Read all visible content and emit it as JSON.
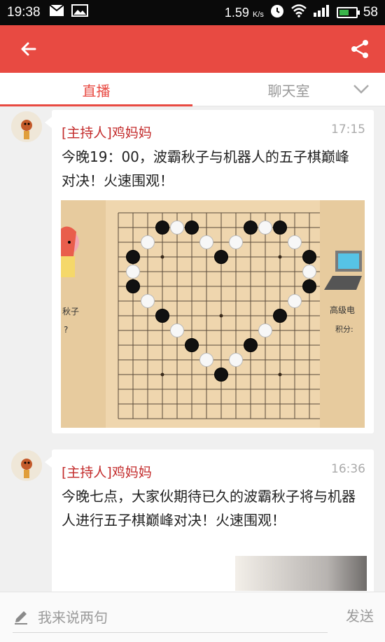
{
  "status_bar": {
    "time": "19:38",
    "speed": "1.59",
    "speed_unit": "K/s",
    "battery": "58",
    "battery_fill": 0.58,
    "icons": [
      "mail-icon",
      "image-icon",
      "alarm-icon",
      "wifi-icon",
      "signal-icon",
      "battery-icon"
    ]
  },
  "app_bar": {
    "color": "#e84a42",
    "back_icon": "back-arrow-icon",
    "share_icon": "share-icon"
  },
  "tabs": {
    "live": "直播",
    "chat": "聊天室",
    "chevron_icon": "chevron-down-icon"
  },
  "posts": [
    {
      "host": "[主持人]鸡妈妈",
      "time": "17:15",
      "text": "今晚19：00，波霸秋子与机器人的五子棋巅峰对决！火速围观！",
      "image": {
        "left_label": "秋子",
        "left_q": "?",
        "right_label": "高级电",
        "right_score": "积分:"
      }
    },
    {
      "host": "[主持人]鸡妈妈",
      "time": "16:36",
      "text": "今晚七点，大家伙期待已久的波霸秋子将与机器人进行五子棋巅峰对决！火速围观！"
    }
  ],
  "input": {
    "placeholder": "我来说两句",
    "send": "发送",
    "pencil_icon": "pencil-icon"
  }
}
